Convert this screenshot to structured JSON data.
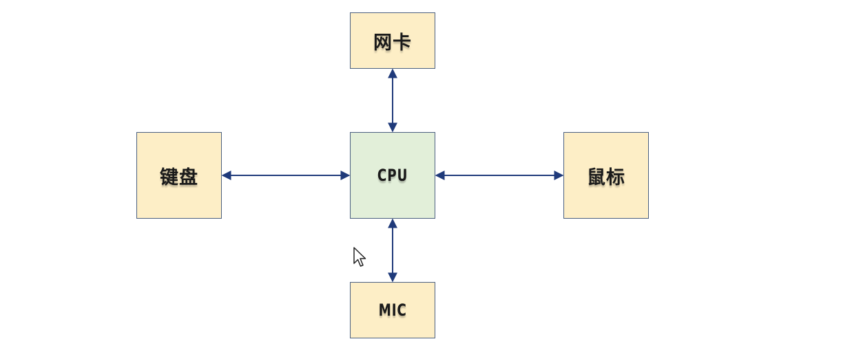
{
  "diagram": {
    "nodes": {
      "top": {
        "label": "网卡"
      },
      "left": {
        "label": "键盘"
      },
      "center": {
        "label": "CPU"
      },
      "right": {
        "label": "鼠标"
      },
      "bottom": {
        "label": "MIC"
      }
    },
    "edges": [
      {
        "from": "center",
        "to": "top",
        "direction": "bidirectional"
      },
      {
        "from": "center",
        "to": "left",
        "direction": "bidirectional"
      },
      {
        "from": "center",
        "to": "right",
        "direction": "bidirectional"
      },
      {
        "from": "center",
        "to": "bottom",
        "direction": "bidirectional"
      }
    ]
  },
  "colors": {
    "peripheral_fill": "#fdeec6",
    "cpu_fill": "#e2efd9",
    "box_border": "#4a5f7f",
    "arrow": "#1f3a7a"
  },
  "cursor": {
    "icon": "mouse-pointer-icon"
  }
}
